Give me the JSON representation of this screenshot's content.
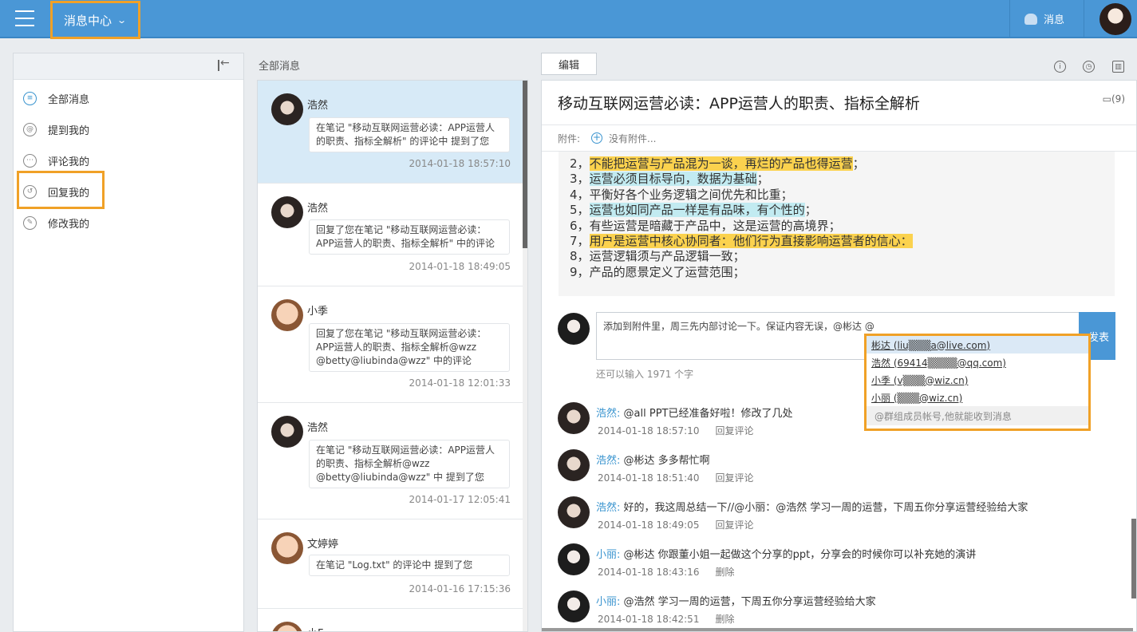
{
  "header": {
    "title": "消息中心",
    "title_chevron": "⌄",
    "msg_label": "消息"
  },
  "leftnav": {
    "items": [
      {
        "label": "全部消息",
        "icon": "list-icon"
      },
      {
        "label": "提到我的",
        "icon": "at-icon"
      },
      {
        "label": "评论我的",
        "icon": "comment-icon"
      },
      {
        "label": "回复我的",
        "icon": "reply-icon"
      },
      {
        "label": "修改我的",
        "icon": "edit-icon"
      }
    ]
  },
  "midlist": {
    "header": "全部消息",
    "messages": [
      {
        "name": "浩然",
        "text": "在笔记 \"移动互联网运营必读：APP运营人的职责、指标全解析\" 的评论中 提到了您",
        "time": "2014-01-18 18:57:10",
        "selected": true
      },
      {
        "name": "浩然",
        "text": "回复了您在笔记 \"移动互联网运营必读：APP运营人的职责、指标全解析\" 中的评论",
        "time": "2014-01-18 18:49:05"
      },
      {
        "name": "小季",
        "text": "回复了您在笔记 \"移动互联网运营必读：APP运营人的职责、指标全解析@wzz @betty@liubinda@wzz\" 中的评论",
        "time": "2014-01-18 12:01:33"
      },
      {
        "name": "浩然",
        "text": "在笔记 \"移动互联网运营必读：APP运营人的职责、指标全解析@wzz @betty@liubinda@wzz\" 中 提到了您",
        "time": "2014-01-17 12:05:41"
      },
      {
        "name": "文婷婷",
        "text": "在笔记 \"Log.txt\" 的评论中 提到了您",
        "time": "2014-01-16 17:15:36"
      },
      {
        "name": "小F",
        "text": "",
        "time": ""
      }
    ]
  },
  "note": {
    "edit_tab": "编辑",
    "title": "移动互联网运营必读：APP运营人的职责、指标全解析",
    "comment_count": "(9)",
    "attach_label": "附件:",
    "attach_add": "+",
    "attach_none": "没有附件...",
    "lines": [
      {
        "num": "2",
        "pre": "，",
        "hl": "不能把运营与产品混为一谈，再烂的产品也得运营",
        "post": "；",
        "color": "yellow"
      },
      {
        "num": "3",
        "pre": "，",
        "hl": "运营必须目标导向，数据为基础",
        "post": "；",
        "color": "cyan"
      },
      {
        "num": "4",
        "pre": "，",
        "hl": "",
        "post": "平衡好各个业务逻辑之间优先和比重；",
        "color": ""
      },
      {
        "num": "5",
        "pre": "，",
        "hl": "运营也如同产品一样是有品味，有个性的",
        "post": "；",
        "color": "cyan"
      },
      {
        "num": "6",
        "pre": "，",
        "hl": "",
        "post": "有些运营是暗藏于产品中，这是运营的高境界；",
        "color": ""
      },
      {
        "num": "7",
        "pre": "，",
        "hl": "用户是运营中核心协同者：他们行为直接影响运营者的信心：",
        "post": "",
        "color": "yellow"
      },
      {
        "num": "8",
        "pre": "，",
        "hl": "",
        "post": "运营逻辑须与产品逻辑一致；",
        "color": ""
      },
      {
        "num": "9",
        "pre": "，",
        "hl": "",
        "post": "产品的愿景定义了运营范围；",
        "color": ""
      }
    ]
  },
  "composer": {
    "text": "添加到附件里，周三先内部讨论一下。保证内容无误，@彬达 @",
    "send": "发表",
    "remaining": "还可以输入 1971 个字"
  },
  "mention_dropdown": {
    "items": [
      "彬达 (liu▒▒▒a@live.com)",
      "浩然 (69414▒▒▒▒@qq.com)",
      "小季 (v▒▒▒@wiz.cn)",
      "小丽 (▒▒▒@wiz.cn)"
    ],
    "hint": "@群组成员帐号,他就能收到消息"
  },
  "comments": [
    {
      "name": "浩然:",
      "text": "@all PPT已经准备好啦！修改了几处",
      "time": "2014-01-18 18:57:10",
      "action": "回复评论",
      "avatar": "girl"
    },
    {
      "name": "浩然:",
      "text": "@彬达 多多帮忙啊",
      "time": "2014-01-18 18:51:40",
      "action": "回复评论",
      "avatar": "girl"
    },
    {
      "name": "浩然:",
      "text": "好的，我这周总结一下//@小丽：@浩然 学习一周的运营，下周五你分享运营经验给大家",
      "time": "2014-01-18 18:49:05",
      "action": "回复评论",
      "avatar": "girl"
    },
    {
      "name": "小丽:",
      "text": "@彬达 你跟董小姐一起做这个分享的ppt，分享会的时候你可以补充她的演讲",
      "time": "2014-01-18 18:43:16",
      "action": "删除",
      "avatar": "dark"
    },
    {
      "name": "小丽:",
      "text": "@浩然 学习一周的运营，下周五你分享运营经验给大家",
      "time": "2014-01-18 18:42:51",
      "action": "删除",
      "avatar": "dark"
    }
  ]
}
